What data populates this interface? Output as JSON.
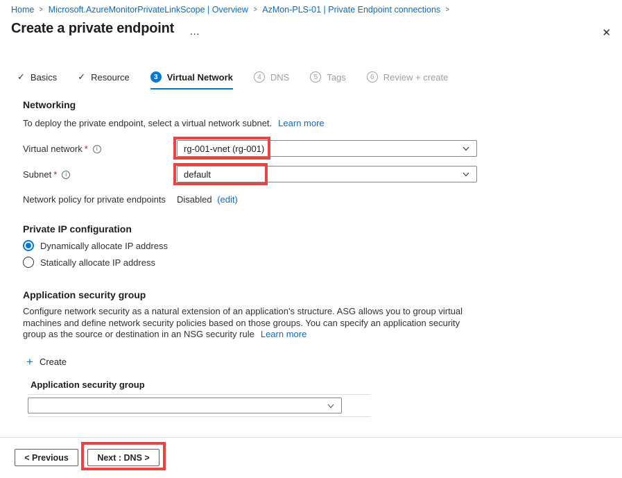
{
  "breadcrumb": {
    "separator": ">",
    "items": [
      {
        "label": "Home"
      },
      {
        "label": "Microsoft.AzureMonitorPrivateLinkScope | Overview"
      },
      {
        "label": "AzMon-PLS-01 | Private Endpoint connections"
      }
    ]
  },
  "header": {
    "title": "Create a private endpoint"
  },
  "icons": {
    "check": "✓",
    "close": "✕",
    "plus": "+",
    "more": "…",
    "info": "i"
  },
  "tabs": [
    {
      "label": "Basics",
      "state": "done"
    },
    {
      "label": "Resource",
      "state": "done"
    },
    {
      "label": "Virtual Network",
      "state": "active",
      "number": "3"
    },
    {
      "label": "DNS",
      "state": "disabled",
      "number": "4"
    },
    {
      "label": "Tags",
      "state": "disabled",
      "number": "5"
    },
    {
      "label": "Review + create",
      "state": "disabled",
      "number": "6"
    }
  ],
  "networking": {
    "heading": "Networking",
    "description": "To deploy the private endpoint, select a virtual network subnet.",
    "learn_more": "Learn more",
    "virtual_network": {
      "label": "Virtual network",
      "required": "*",
      "value": "rg-001-vnet (rg-001)"
    },
    "subnet": {
      "label": "Subnet",
      "required": "*",
      "value": "default"
    },
    "network_policy": {
      "label": "Network policy for private endpoints",
      "value": "Disabled",
      "edit_link": "(edit)"
    }
  },
  "private_ip": {
    "heading": "Private IP configuration",
    "options": [
      {
        "label": "Dynamically allocate IP address",
        "selected": true
      },
      {
        "label": "Statically allocate IP address",
        "selected": false
      }
    ]
  },
  "asg": {
    "heading": "Application security group",
    "description": "Configure network security as a natural extension of an application's structure. ASG allows you to group virtual machines and define network security policies based on those groups. You can specify an application security group as the source or destination in an NSG security rule",
    "learn_more": "Learn more",
    "create_label": "Create",
    "column_header": "Application security group",
    "dropdown_value": ""
  },
  "footer": {
    "previous_label": "< Previous",
    "next_label": "Next : DNS >"
  },
  "colors": {
    "accent_blue": "#0078d4",
    "annotation_red": "#e84345",
    "text_dark": "#1f1e1d",
    "text_disabled": "#a19f9d",
    "required_red": "#a4262c",
    "border_gray": "#878684"
  }
}
